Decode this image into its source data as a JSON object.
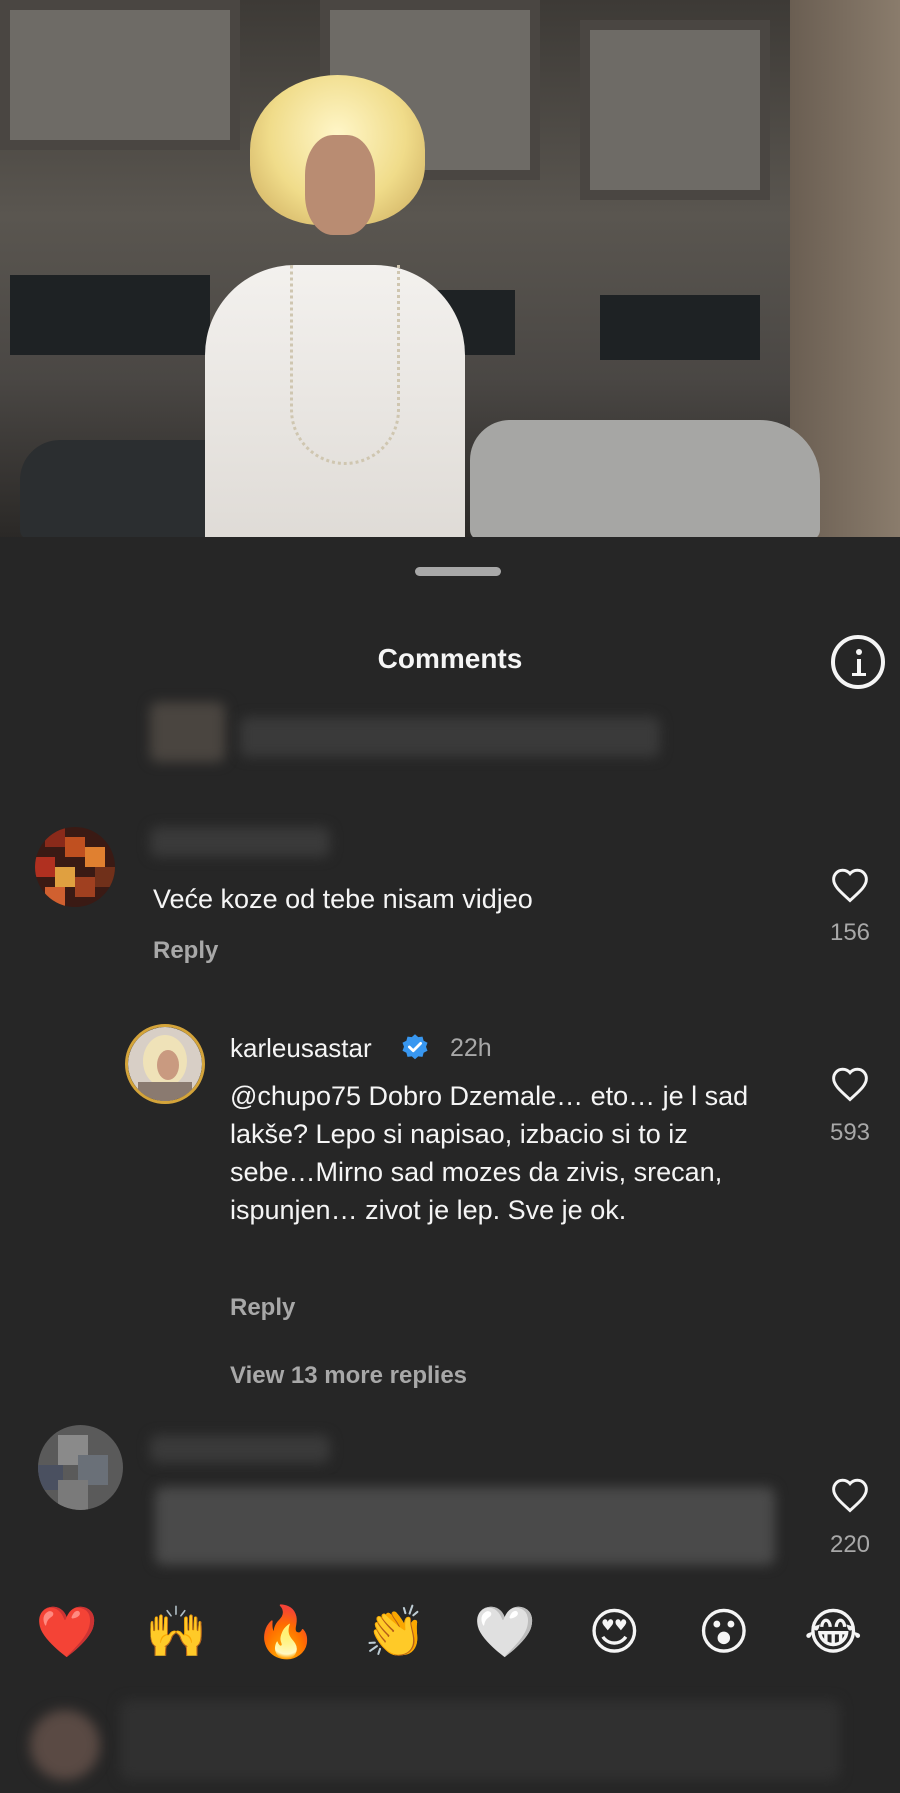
{
  "sheet": {
    "title": "Comments"
  },
  "comments": [
    {
      "text": "Veće koze od tebe nisam vidjeo",
      "reply_label": "Reply",
      "likes": "156"
    },
    {
      "username": "karleusastar",
      "timestamp": "22h",
      "text": "@chupo75 Dobro Dzemale… eto… je l sad lakše? Lepo si napisao, izbacio si to iz sebe…Mirno sad mozes da zivis, srecan, ispunjen… zivot je lep. Sve je ok.",
      "reply_label": "Reply",
      "likes": "593",
      "view_more": "View 13 more replies"
    },
    {
      "likes": "220"
    }
  ],
  "emoji_bar": [
    "❤️",
    "🙌",
    "🔥",
    "👏",
    "🤍",
    "😍",
    "😮",
    "😂"
  ],
  "colors": {
    "background": "#262626",
    "text_primary": "#f5f5f5",
    "text_secondary": "#a8a8a8",
    "verified_blue": "#3897f0",
    "story_ring": "#d4a43a"
  }
}
